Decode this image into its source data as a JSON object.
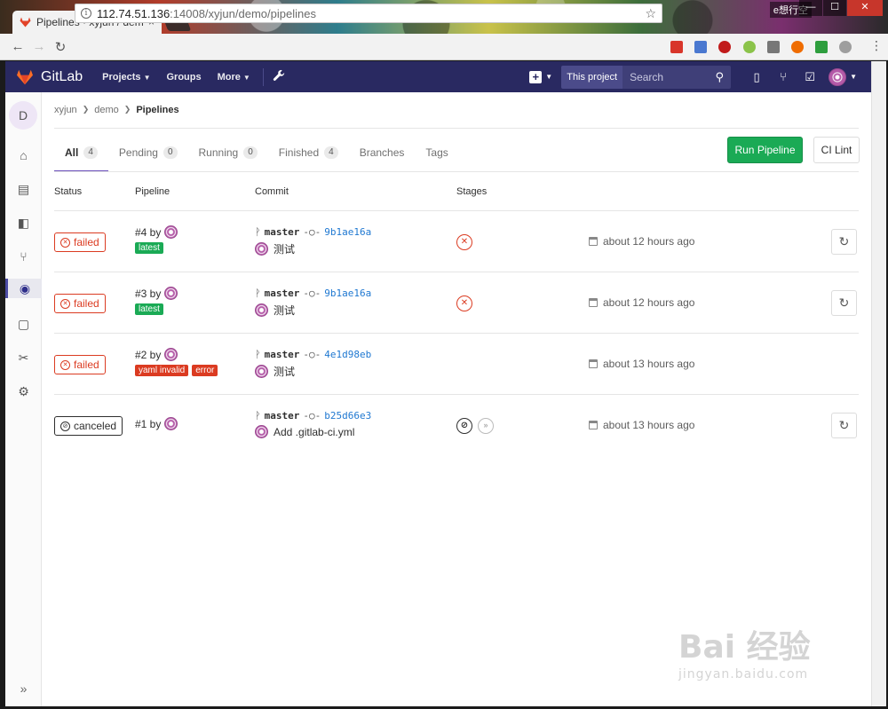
{
  "browser": {
    "tab_title": "Pipelines · xyjun / demo",
    "tab_close": "×",
    "url_host": "112.74.51.136",
    "url_path": ":14008/xyjun/demo/pipelines",
    "user_label": "e想行空",
    "win_min": "—",
    "win_max": "☐",
    "win_close": "✕"
  },
  "header": {
    "brand": "GitLab",
    "menu": [
      "Projects",
      "Groups",
      "More"
    ],
    "search_scope": "This project",
    "search_placeholder": "Search"
  },
  "sidebar": {
    "project_initial": "D"
  },
  "breadcrumb": [
    "xyjun",
    "demo",
    "Pipelines"
  ],
  "tabs": [
    {
      "label": "All",
      "count": "4"
    },
    {
      "label": "Pending",
      "count": "0"
    },
    {
      "label": "Running",
      "count": "0"
    },
    {
      "label": "Finished",
      "count": "4"
    },
    {
      "label": "Branches",
      "count": ""
    },
    {
      "label": "Tags",
      "count": ""
    }
  ],
  "actions": {
    "run_pipeline": "Run Pipeline",
    "ci_lint": "CI Lint"
  },
  "columns": [
    "Status",
    "Pipeline",
    "Commit",
    "Stages"
  ],
  "pipelines": [
    {
      "status": "failed",
      "id": "#4 by",
      "labels": [
        "latest"
      ],
      "branch": "master",
      "sha": "9b1ae16a",
      "message": "测试",
      "stages": [
        "failed"
      ],
      "time": "about 12 hours ago",
      "retry": true
    },
    {
      "status": "failed",
      "id": "#3 by",
      "labels": [
        "latest"
      ],
      "branch": "master",
      "sha": "9b1ae16a",
      "message": "测试",
      "stages": [
        "failed"
      ],
      "time": "about 12 hours ago",
      "retry": true
    },
    {
      "status": "failed",
      "id": "#2 by",
      "labels": [
        "yaml invalid",
        "error"
      ],
      "branch": "master",
      "sha": "4e1d98eb",
      "message": "测试",
      "stages": [],
      "time": "about 13 hours ago",
      "retry": false
    },
    {
      "status": "canceled",
      "id": "#1 by",
      "labels": [],
      "branch": "master",
      "sha": "b25d66e3",
      "message": "Add .gitlab-ci.yml",
      "stages": [
        "canceled",
        "skipped"
      ],
      "time": "about 13 hours ago",
      "retry": true
    }
  ],
  "watermark": {
    "main": "Bai 经验",
    "sub": "jingyan.baidu.com"
  },
  "colors": {
    "header": "#292961",
    "success": "#1aaa55",
    "danger": "#db3b21",
    "link": "#1f78d1"
  }
}
